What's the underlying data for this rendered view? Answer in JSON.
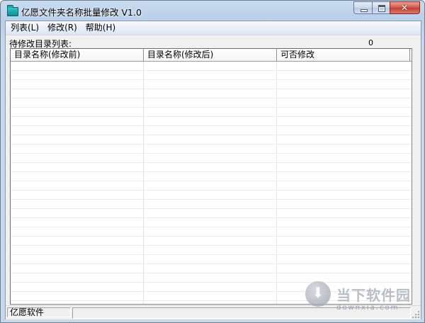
{
  "window": {
    "title": "亿愿文件夹名称批量修改 V1.0",
    "icon": "folder-icon",
    "controls": {
      "minimize": "minimize-icon",
      "maximize": "maximize-icon",
      "close_glyph": "✕"
    }
  },
  "menubar": {
    "items": [
      {
        "label": "列表(L)"
      },
      {
        "label": "修改(R)"
      },
      {
        "label": "帮助(H)"
      }
    ]
  },
  "list": {
    "caption": "待修改目录列表:",
    "count": "0",
    "columns": [
      {
        "label": "目录名称(修改前)"
      },
      {
        "label": "目录名称(修改后)"
      },
      {
        "label": "可否修改"
      }
    ],
    "rows": []
  },
  "statusbar": {
    "pane1": "亿愿软件",
    "pane2": ""
  },
  "watermark": {
    "icon": "download-icon",
    "text": "当下软件园",
    "domain": "downxia.com"
  }
}
